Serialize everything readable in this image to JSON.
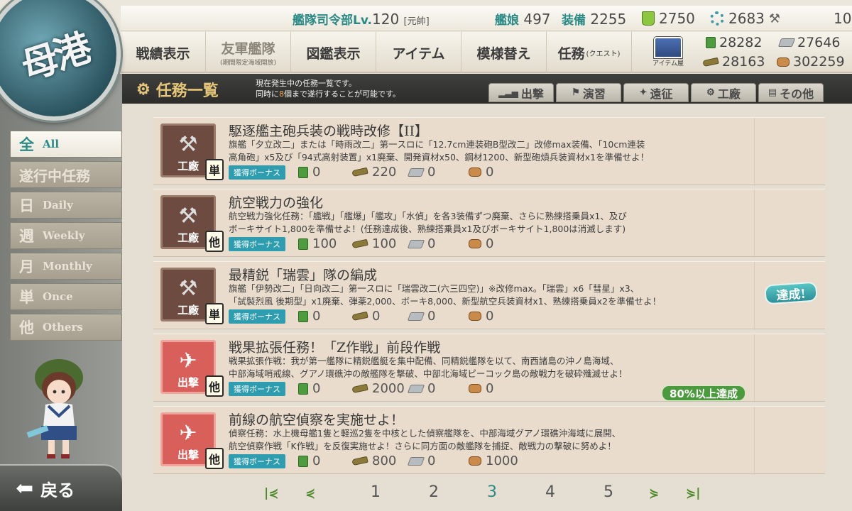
{
  "status": {
    "hq_label": "艦隊司令部Lv.",
    "hq_level": "120",
    "rank": "[元帥]",
    "ships_label": "艦娘",
    "ships": "497",
    "equip_label": "装備",
    "equip": "2255",
    "buckets": "2750",
    "dev_materials": "2683",
    "screws": "10"
  },
  "port_button": {
    "label": "母港"
  },
  "nav": [
    {
      "label": "戦績表示",
      "sub": ""
    },
    {
      "label": "友軍艦隊",
      "sub": "(期間限定海域開放)"
    },
    {
      "label": "図鑑表示",
      "sub": ""
    },
    {
      "label": "アイテム",
      "sub": ""
    },
    {
      "label": "模様替え",
      "sub": ""
    },
    {
      "label": "任務",
      "suffix": "(クエスト)"
    }
  ],
  "shop": {
    "label": "アイテム屋"
  },
  "resources": {
    "fuel": "28282",
    "steel": "27646",
    "ammo": "28163",
    "bauxite": "302259"
  },
  "header": {
    "title": "任務一覧",
    "desc_line1": "現在発生中の任務一覧です。",
    "desc_line2_a": "同時に",
    "desc_line2_num": "8",
    "desc_line2_b": "個まで遂行することが可能です。"
  },
  "filter_tabs": [
    "出撃",
    "演習",
    "遠征",
    "工廠",
    "その他"
  ],
  "categories": [
    {
      "kanji": "全",
      "en": "All"
    },
    {
      "kanji": "遂行中任務",
      "en": ""
    },
    {
      "kanji": "日",
      "en": "Daily"
    },
    {
      "kanji": "週",
      "en": "Weekly"
    },
    {
      "kanji": "月",
      "en": "Monthly"
    },
    {
      "kanji": "単",
      "en": "Once"
    },
    {
      "kanji": "他",
      "en": "Others"
    }
  ],
  "bonus_label": "獲得ボーナス",
  "quests": [
    {
      "type": "工廠",
      "freq": "単",
      "title": "駆逐艦主砲兵装の戦時改修【II】",
      "desc1": "旗艦「夕立改二」または「時雨改二」第一スロに「12.7cm連装砲B型改二」改修max装備、「10cm連装",
      "desc2": "高角砲」x5及び「94式高射装置」x1廃棄、開発資材x50、鋼材1200、新型砲熕兵装資材x1を準備せよ！",
      "fuel": "0",
      "ammo": "220",
      "steel": "0",
      "bauxite": "0",
      "bauxite_val": "0"
    },
    {
      "type": "工廠",
      "freq": "他",
      "title": "航空戦力の強化",
      "desc1": "航空戦力強化任務：「艦戦」「艦爆」「艦攻」「水偵」を各3装備ずつ廃棄、さらに熟練搭乗員x1、及び",
      "desc2": "ボーキサイト1,800を準備せよ！(任務達成後、熟練搭乗員x1及びボーキサイト1,800は消滅します)",
      "fuel": "100",
      "ammo": "100",
      "steel": "0",
      "bauxite": "0"
    },
    {
      "type": "工廠",
      "freq": "単",
      "title": "最精鋭「瑞雲」隊の編成",
      "desc1": "旗艦「伊勢改二」「日向改二」第一スロに「瑞雲改二(六三四空)」※改修max。「瑞雲」x6「彗星」x3、",
      "desc2": "「試製烈風 後期型」x1廃棄、弾薬2,000、ボーキ8,000、新型航空兵装資材x1、熟練搭乗員x2を準備せよ！",
      "fuel": "0",
      "ammo": "0",
      "steel": "0",
      "bauxite": "0",
      "stamp": "達成!"
    },
    {
      "type": "出撃",
      "freq": "他",
      "title": "戦果拡張任務！「Z作戦」前段作戦",
      "desc1": "戦果拡張作戦：我が第一艦隊に精鋭艦艇を集中配備、同精鋭艦隊を以て、南西諸島の沖ノ島海域、",
      "desc2": "中部海域哨戒線、グアノ環礁沖の敵艦隊を撃破、中部北海域ピーコック島の敵戦力を破砕殲滅せよ！",
      "fuel": "0",
      "ammo": "2000",
      "steel": "0",
      "bauxite": "0",
      "progress": "80%以上達成"
    },
    {
      "type": "出撃",
      "freq": "他",
      "title": "前線の航空偵察を実施せよ！",
      "desc1": "偵察任務：水上機母艦1隻と軽巡2隻を中核とした偵察艦隊を、中部海域グアノ環礁沖海域に展開、",
      "desc2": "航空偵察作戦「K作戦」を反復実施せよ！さらに同方面の敵艦隊を捕捉、敵戦力の撃破に努めよ！",
      "fuel": "0",
      "ammo": "800",
      "steel": "0",
      "bauxite": "1000"
    }
  ],
  "pager": {
    "pages": [
      "1",
      "2",
      "3",
      "4",
      "5"
    ],
    "current": "3"
  },
  "back_button": {
    "label": "戻る"
  },
  "colors": {
    "accent": "#2a8a86",
    "bonus": "#2f9db0",
    "header_title": "#e6c678"
  }
}
